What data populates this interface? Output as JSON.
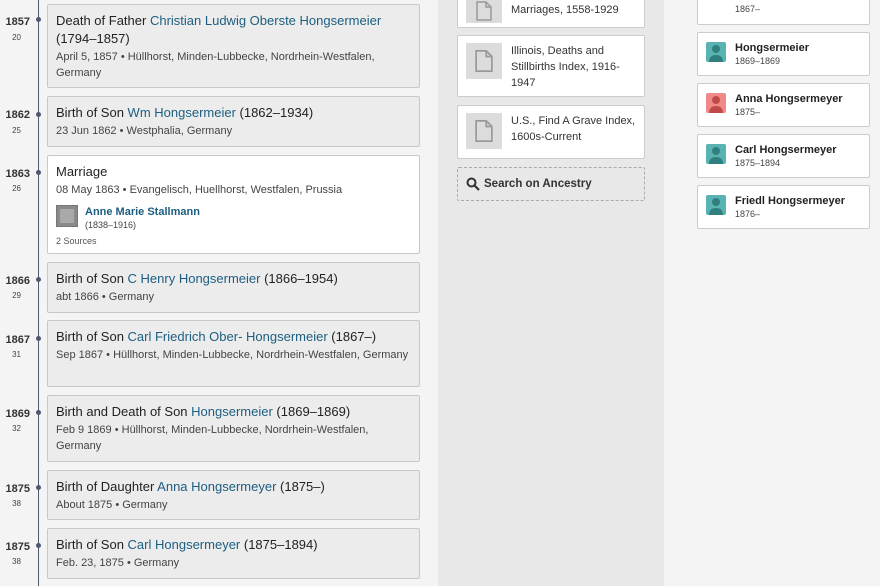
{
  "timeline": {
    "events": [
      {
        "year": "1857",
        "age": "20",
        "title_prefix": "Death of Father ",
        "link": "Christian Ludwig Oberste Hongsermeier",
        "years": " (1794–1857)",
        "detail": "April 5, 1857 • Hüllhorst, Minden-Lubbecke, Nordrhein-Westfalen, Germany"
      },
      {
        "year": "1862",
        "age": "25",
        "title_prefix": "Birth of Son ",
        "link": "Wm Hongsermeier",
        "years": " (1862–1934)",
        "detail": "23 Jun 1862 • Westphalia, Germany"
      },
      {
        "year": "1863",
        "age": "26",
        "title": "Marriage",
        "detail": "08 May 1863 • Evangelisch, Huellhorst, Westfalen, Prussia",
        "spouse_name": "Anne Marie Stallmann",
        "spouse_years": "(1838–1916)",
        "sources": "2 Sources"
      },
      {
        "year": "1866",
        "age": "29",
        "title_prefix": "Birth of Son ",
        "link": "C Henry Hongsermeier",
        "years": " (1866–1954)",
        "detail": "abt 1866 • Germany"
      },
      {
        "year": "1867",
        "age": "31",
        "title_prefix": "Birth of Son ",
        "link": "Carl Friedrich Ober- Hongsermeier",
        "years": " (1867–)",
        "detail": "Sep 1867 • Hüllhorst, Minden-Lubbecke, Nordrhein-Westfalen, Germany"
      },
      {
        "year": "1869",
        "age": "32",
        "title_prefix": "Birth and Death of Son ",
        "link": "Hongsermeier",
        "years": " (1869–1869)",
        "detail": "Feb 9 1869 • Hüllhorst, Minden-Lubbecke, Nordrhein-Westfalen, Germany"
      },
      {
        "year": "1875",
        "age": "38",
        "title_prefix": "Birth of Daughter ",
        "link": "Anna Hongsermeyer",
        "years": " (1875–)",
        "detail": "About 1875 • Germany"
      },
      {
        "year": "1875",
        "age": "38",
        "title_prefix": "Birth of Son ",
        "link": "Carl Hongsermeyer",
        "years": " (1875–1894)",
        "detail": "Feb. 23, 1875 • Germany"
      }
    ]
  },
  "sources": {
    "items": [
      {
        "label": "Marriages, 1558-1929"
      },
      {
        "label": "Illinois, Deaths and Stillbirths Index, 1916-1947"
      },
      {
        "label": "U.S., Find A Grave Index, 1600s-Current"
      }
    ],
    "search_label": "Search on Ancestry"
  },
  "family": {
    "people": [
      {
        "name": "",
        "years": "1867–",
        "gender": "male"
      },
      {
        "name": "Hongsermeier",
        "years": "1869–1869",
        "gender": "male"
      },
      {
        "name": "Anna Hongsermeyer",
        "years": "1875–",
        "gender": "female"
      },
      {
        "name": "Carl Hongsermeyer",
        "years": "1875–1894",
        "gender": "male"
      },
      {
        "name": "Friedl Hongsermeyer",
        "years": "1876–",
        "gender": "male"
      }
    ]
  },
  "colors": {
    "male": "#5ab3b3",
    "female": "#f08a8a",
    "link": "#1d5e80",
    "timeline": "#4a5a70"
  }
}
